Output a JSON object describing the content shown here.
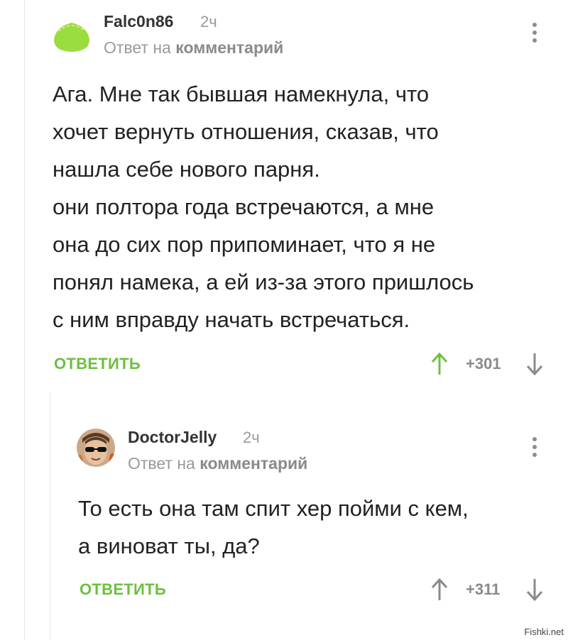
{
  "comments": [
    {
      "username": "Falc0n86",
      "time": "2ч",
      "reply_prefix": "Ответ на",
      "reply_target": "комментарий",
      "text_lines": [
        "Ага. Мне так бывшая намекнула, что",
        "хочет вернуть отношения, сказав, что",
        "нашла себе нового парня.",
        "они полтора года встречаются, а мне",
        "она до сих пор припоминает, что я не",
        "понял намека, а ей из-за этого пришлось",
        "с ним вправду начать встречаться."
      ],
      "reply_label": "ОТВЕТИТЬ",
      "score": "+301",
      "upvoted": true,
      "avatar_icon": "green-blob-avatar"
    },
    {
      "username": "DoctorJelly",
      "time": "2ч",
      "reply_prefix": "Ответ на",
      "reply_target": "комментарий",
      "text_lines": [
        "То есть она там спит хер пойми с кем,",
        "а виноват ты, да?"
      ],
      "reply_label": "ОТВЕТИТЬ",
      "score": "+311",
      "upvoted": false,
      "avatar_icon": "sunglasses-face-avatar"
    }
  ],
  "colors": {
    "accent_green": "#6dbf3f",
    "muted_gray": "#9a9a9a",
    "text": "#222222"
  },
  "watermark": "Fishki.net"
}
